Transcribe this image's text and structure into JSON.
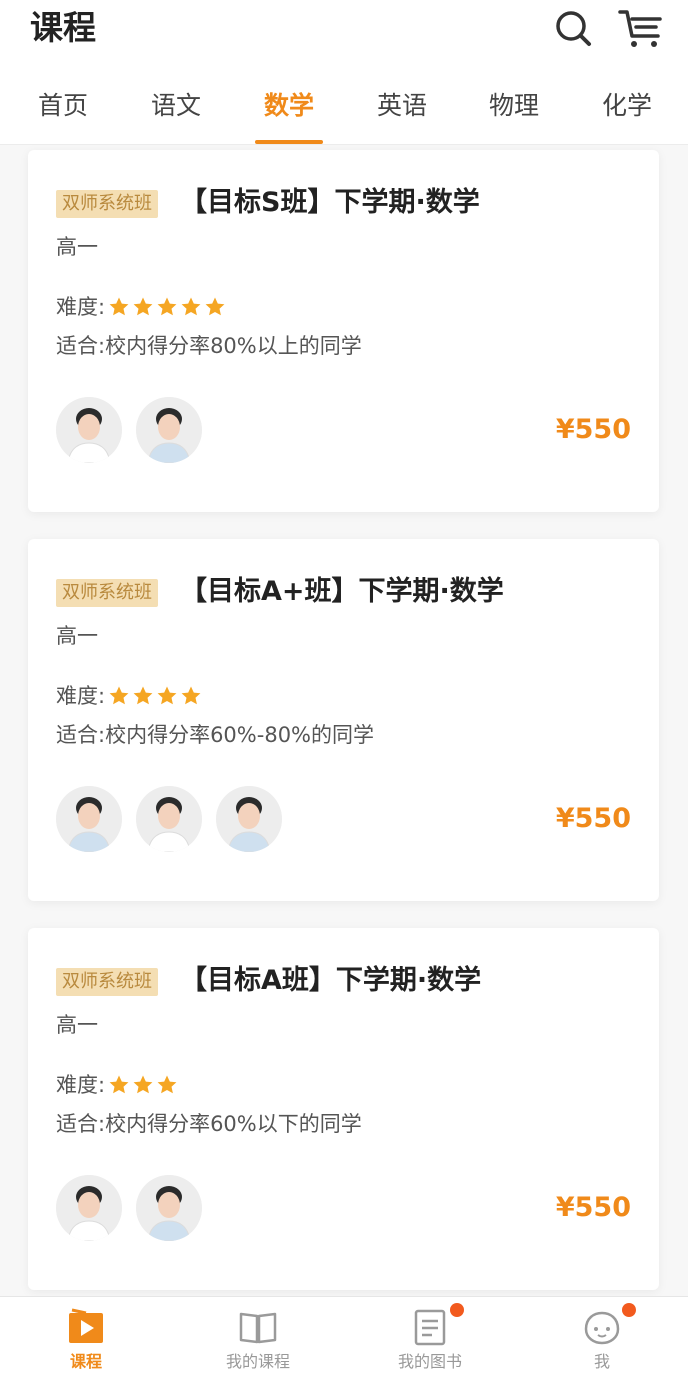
{
  "header": {
    "title": "课程",
    "search_icon": "search-icon",
    "cart_icon": "cart-icon"
  },
  "tabs": [
    {
      "label": "首页",
      "active": false
    },
    {
      "label": "语文",
      "active": false
    },
    {
      "label": "数学",
      "active": true
    },
    {
      "label": "英语",
      "active": false
    },
    {
      "label": "物理",
      "active": false
    },
    {
      "label": "化学",
      "active": false
    }
  ],
  "courses": [
    {
      "badge": "双师系统班",
      "title": "【目标S班】下学期·数学",
      "grade": "高一",
      "difficulty_label": "难度:",
      "difficulty_stars": 5,
      "suitable": "适合:校内得分率80%以上的同学",
      "teacher_count": 2,
      "price": "¥550"
    },
    {
      "badge": "双师系统班",
      "title": "【目标A+班】下学期·数学",
      "grade": "高一",
      "difficulty_label": "难度:",
      "difficulty_stars": 4,
      "suitable": "适合:校内得分率60%-80%的同学",
      "teacher_count": 3,
      "price": "¥550"
    },
    {
      "badge": "双师系统班",
      "title": "【目标A班】下学期·数学",
      "grade": "高一",
      "difficulty_label": "难度:",
      "difficulty_stars": 3,
      "suitable": "适合:校内得分率60%以下的同学",
      "teacher_count": 2,
      "price": "¥550"
    }
  ],
  "bottom_nav": [
    {
      "label": "课程",
      "icon": "play-icon",
      "active": true,
      "dot": false
    },
    {
      "label": "我的课程",
      "icon": "book-open-icon",
      "active": false,
      "dot": false
    },
    {
      "label": "我的图书",
      "icon": "notebook-icon",
      "active": false,
      "dot": true
    },
    {
      "label": "我",
      "icon": "profile-face-icon",
      "active": false,
      "dot": true
    }
  ],
  "colors": {
    "accent": "#f08a1a",
    "star": "#f5a623",
    "badge_bg": "#f4deb3",
    "badge_text": "#b98a3e",
    "dot": "#f25a1e"
  }
}
